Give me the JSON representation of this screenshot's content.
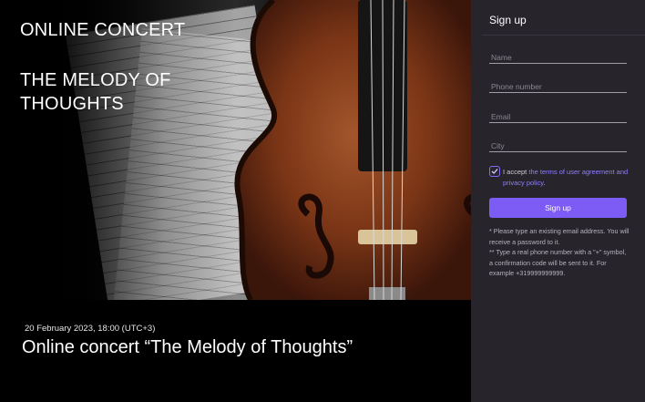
{
  "hero": {
    "heading": "ONLINE CONCERT",
    "subheading": "THE MELODY OF THOUGHTS"
  },
  "event": {
    "date": "20 February 2023, 18:00 (UTC+3)",
    "title": "Online concert “The Melody of Thoughts”"
  },
  "signup": {
    "title": "Sign up",
    "fields": {
      "name_placeholder": "Name",
      "phone_placeholder": "Phone number",
      "email_placeholder": "Email",
      "city_placeholder": "City"
    },
    "agreement": {
      "prefix": "I accept ",
      "link_text": "the terms of user agreement and privacy policy",
      "suffix": ".",
      "checked": true
    },
    "button_label": "Sign up",
    "note_email": "* Please type an existing email address. You will receive a password to it.",
    "note_phone": "** Type a real phone number with a \"+\" symbol, a confirmation code will be sent to it. For example +319999999999."
  },
  "colors": {
    "accent": "#7c5cf5",
    "panel_bg": "#27242c",
    "link": "#8e7fff"
  }
}
